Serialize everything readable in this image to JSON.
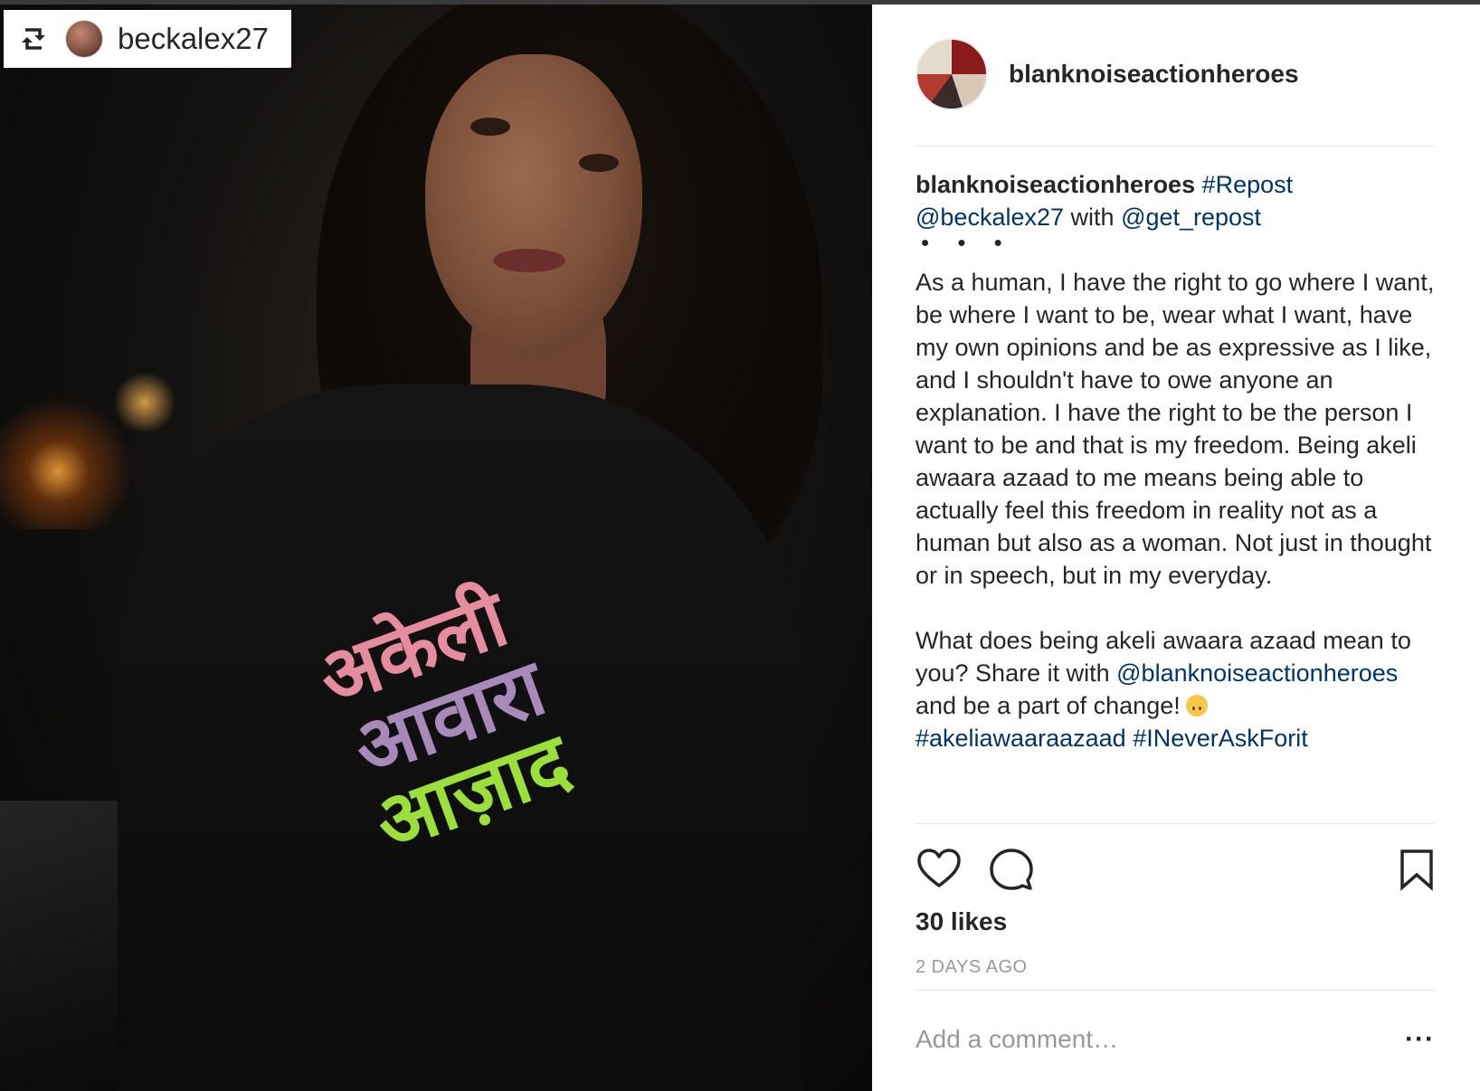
{
  "photo": {
    "shirt_text": [
      "अकेली",
      "आवारा",
      "आज़ाद"
    ]
  },
  "repost_badge": {
    "icon": "repost-icon",
    "username": "beckalex27"
  },
  "post": {
    "author": "blanknoiseactionheroes",
    "caption": {
      "username": "blanknoiseactionheroes",
      "hashtag_repost": "#Repost",
      "mention_user": "@beckalex27",
      "with_text": "with",
      "mention_tool": "@get_repost",
      "dots": "• • •",
      "paragraph1": "As a human, I have the right to go where I want, be where I want to be, wear what I want, have my own opinions and be as expressive as I like, and I shouldn't have to owe anyone an explanation. I have the right to be the person I want to be and that is my freedom. Being akeli awaara azaad to me means being able to actually feel this freedom in reality not as a human but also as a woman. Not just in thought or in speech, but in my everyday.",
      "paragraph2_start": "What does being akeli awaara azaad mean to you? Share it with",
      "mention_account": "@blanknoiseactionheroes",
      "paragraph2_end": "and be a part of change!",
      "emoji": "upside-down-face-emoji",
      "hashtag1": "#akeliawaaraazaad",
      "hashtag2": "#INeverAskForit"
    },
    "likes": "30 likes",
    "timestamp": "2 DAYS AGO",
    "comment_placeholder": "Add a comment…",
    "more_label": "···",
    "icons": {
      "like": "heart-icon",
      "comment": "comment-icon",
      "save": "bookmark-icon",
      "more": "more-icon"
    }
  },
  "colors": {
    "link": "#003569",
    "text": "#262626",
    "muted": "#999999",
    "divider": "#e4e4e4"
  }
}
